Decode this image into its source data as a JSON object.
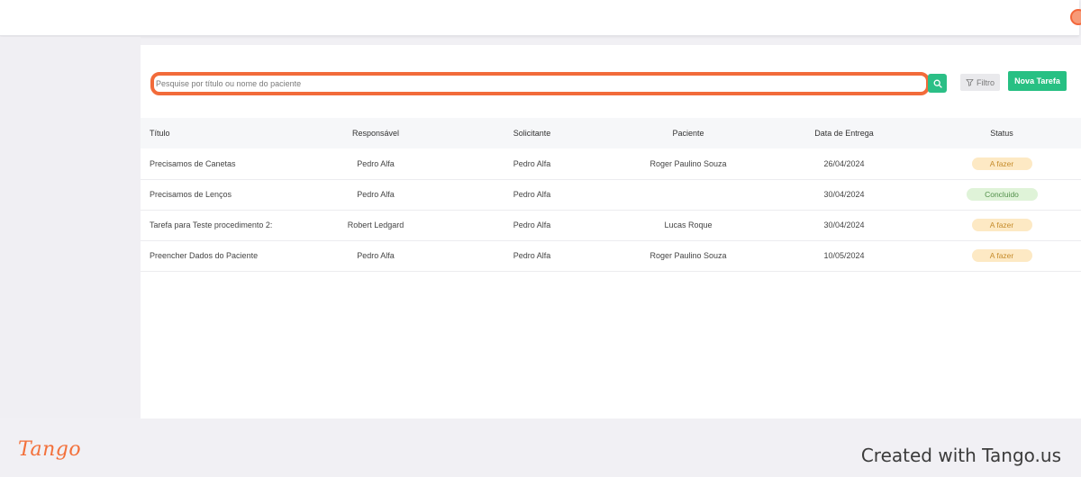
{
  "search": {
    "placeholder": "Pesquise por título ou nome do paciente"
  },
  "toolbar": {
    "filter_label": "Filtro",
    "new_task_label": "Nova Tarefa"
  },
  "table": {
    "headers": {
      "title": "Título",
      "responsible": "Responsável",
      "requester": "Solicitante",
      "patient": "Paciente",
      "due_date": "Data de Entrega",
      "status": "Status"
    },
    "rows": [
      {
        "title": "Precisamos de Canetas",
        "responsible": "Pedro Alfa",
        "requester": "Pedro Alfa",
        "patient": "Roger Paulino Souza",
        "due_date": "26/04/2024",
        "status": "A fazer"
      },
      {
        "title": "Precisamos de Lenços",
        "responsible": "Pedro Alfa",
        "requester": "Pedro Alfa",
        "patient": "",
        "due_date": "30/04/2024",
        "status": "Concluido"
      },
      {
        "title": "Tarefa para Teste procedimento 2:",
        "responsible": "Robert Ledgard",
        "requester": "Pedro Alfa",
        "patient": "Lucas Roque",
        "due_date": "30/04/2024",
        "status": "A fazer"
      },
      {
        "title": "Preencher Dados do Paciente",
        "responsible": "Pedro Alfa",
        "requester": "Pedro Alfa",
        "patient": "Roger Paulino Souza",
        "due_date": "10/05/2024",
        "status": "A fazer"
      }
    ]
  },
  "footer": {
    "logo_text": "Tango",
    "created_with": "Created with Tango.us"
  },
  "colors": {
    "accent_green": "#27c083",
    "highlight_orange": "#f26b3a",
    "badge_todo_bg": "#fde9c4",
    "badge_done_bg": "#dff3d8"
  },
  "icons": {
    "search": "search-icon",
    "filter": "filter-icon"
  }
}
